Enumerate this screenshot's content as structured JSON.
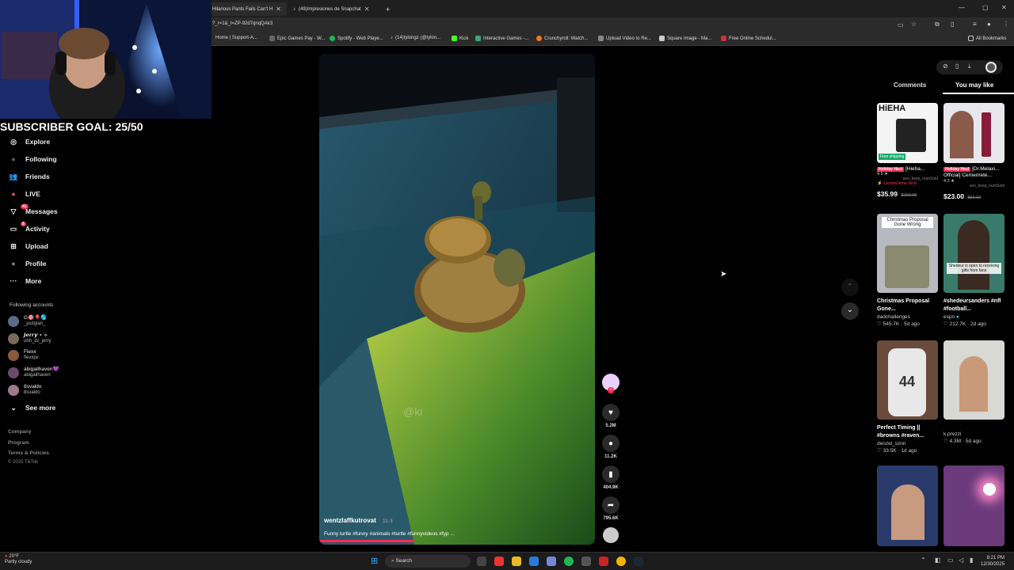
{
  "browser": {
    "tabs": [
      {
        "label": "Hilarious Pants Fails Can't H",
        "close": "✕"
      },
      {
        "label": "(49)Impresiones de Snapchat",
        "close": "✕"
      }
    ],
    "new_tab": "+",
    "url": "?_r=1&_t=ZP-92d7qnqQAk3",
    "bookmarks": [
      "Home | Support-A...",
      "Epic Games Pay - W...",
      "Spotify - Web Playe...",
      "(14)tylongz (@tylon...",
      "Kick",
      "Interactive Games -...",
      "Crunchyroll: Watch...",
      "Upload Video to Re...",
      "Square Image - Ma...",
      "Free Online Schedul..."
    ],
    "all_bookmarks": "All Bookmarks"
  },
  "overlay": {
    "subscriber_goal": "SUBSCRIBER GOAL: 25/50"
  },
  "sidebar": {
    "nav": [
      {
        "label": "Explore",
        "icon": "compass-icon",
        "glyph": "◎"
      },
      {
        "label": "Following",
        "icon": "following-icon",
        "glyph": "●"
      },
      {
        "label": "Friends",
        "icon": "friends-icon",
        "glyph": "👥"
      },
      {
        "label": "LIVE",
        "icon": "live-icon",
        "glyph": "●"
      },
      {
        "label": "Messages",
        "icon": "messages-icon",
        "glyph": "▽",
        "badge": "41"
      },
      {
        "label": "Activity",
        "icon": "activity-icon",
        "glyph": "▭",
        "badge": "8"
      },
      {
        "label": "Upload",
        "icon": "upload-icon",
        "glyph": "⊞"
      },
      {
        "label": "Profile",
        "icon": "profile-icon",
        "glyph": "●"
      },
      {
        "label": "More",
        "icon": "more-icon",
        "glyph": "···"
      }
    ],
    "following_title": "Following accounts",
    "following": [
      {
        "name": "G🎯🎈🌎",
        "handle": "_justgian_",
        "color": "#5a6b8a"
      },
      {
        "name": "𝙅𝙚𝙧𝙧𝙮 ⋆˙⟡",
        "handle": "uhh_itz_jerry",
        "color": "#7a6a5a"
      },
      {
        "name": "Flexx",
        "handle": "flexxpv",
        "color": "#8a5a3a"
      },
      {
        "name": "abigailhaven💜",
        "handle": "abigailhaven",
        "color": "#6a4a6a"
      },
      {
        "name": "8svaldo",
        "handle": "8svaldo",
        "color": "#a07a8a"
      }
    ],
    "see_more": "See more",
    "footer": [
      "Company",
      "Program",
      "Terms & Policies",
      "© 2025 TikTok"
    ]
  },
  "video": {
    "username": "wentzlaffkutrovat",
    "date": "11-3",
    "caption": "Funny turtle #funny #animals #turtle #funnyvideos #fyp ...",
    "watermark": "@ki",
    "actions": [
      {
        "name": "like",
        "icon": "heart-icon",
        "glyph": "♥",
        "count": "5.2M"
      },
      {
        "name": "comment",
        "icon": "comment-icon",
        "glyph": "●",
        "count": "11.2K"
      },
      {
        "name": "save",
        "icon": "bookmark-icon",
        "glyph": "▮",
        "count": "404.9K"
      },
      {
        "name": "share",
        "icon": "share-icon",
        "glyph": "➦",
        "count": "795.6K"
      }
    ]
  },
  "right_panel": {
    "tabs": [
      "Comments",
      "You may like"
    ],
    "active_tab": "You may like",
    "products": [
      {
        "badge": "Holiday Haul",
        "title": "[Hieha...",
        "rating": "4.5 ★",
        "sold": "seo_keep_numSold",
        "deal": "⚡ Limited time deal",
        "price": "$35.99",
        "old_price": "$159.99",
        "thumb_label": "HiEHA",
        "ship": "Free shipping"
      },
      {
        "badge": "Holiday Haul",
        "title": "[Dr.Melaxi... Official] Cemenrete...",
        "rating": "4.3 ★",
        "sold": "seo_keep_numSold",
        "deal": "",
        "price": "$23.00",
        "old_price": "$56.00",
        "thumb_label": "",
        "ship": ""
      }
    ],
    "videos": [
      {
        "title": "Christmas Proposal Gone...",
        "author": "dadchallenges",
        "likes": "545.7K",
        "age": "5d ago",
        "thumb_label": "Christmas Proposal Gone Wrong"
      },
      {
        "title": "#shedeursanders #nfl #football...",
        "author": "espn",
        "likes": "212.7K",
        "age": "2d ago",
        "thumb_label": "Shedeur is open to receiving gifts from fans"
      },
      {
        "title": "Perfect Timing || #browns #raven...",
        "author": "denzel_sznn",
        "likes": "33.5K",
        "age": "1d ago",
        "thumb_label": "44"
      },
      {
        "title": "",
        "author": "k.prezzi",
        "likes": "4.3M",
        "age": "5d ago",
        "thumb_label": ""
      }
    ]
  },
  "taskbar": {
    "weather_temp": "20°F",
    "weather_desc": "Partly cloudy",
    "search": "Search",
    "time": "8:21 PM",
    "date": "12/30/2025"
  }
}
